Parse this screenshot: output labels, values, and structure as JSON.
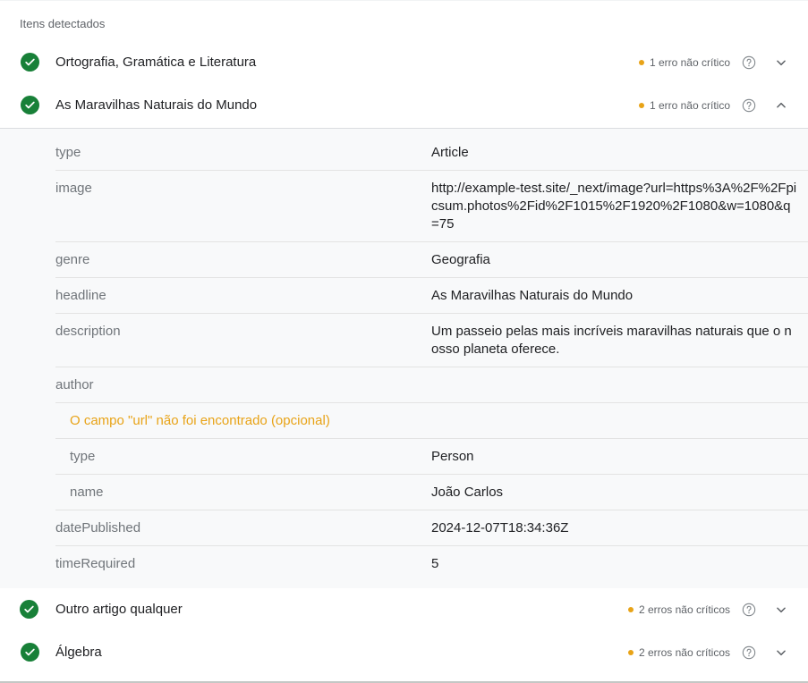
{
  "section_title": "Itens detectados",
  "colors": {
    "check": "#188038",
    "warning_dot": "#e8a317",
    "warning_text": "#e8a317"
  },
  "items": [
    {
      "title": "Ortografia, Gramática e Literatura",
      "warning": "1 erro não crítico",
      "expanded": false
    },
    {
      "title": "As Maravilhas Naturais do Mundo",
      "warning": "1 erro não crítico",
      "expanded": true
    },
    {
      "title": "Outro artigo qualquer",
      "warning": "2 erros não críticos",
      "expanded": false
    },
    {
      "title": "Álgebra",
      "warning": "2 erros não críticos",
      "expanded": false
    }
  ],
  "details": {
    "type": {
      "key": "type",
      "value": "Article"
    },
    "image": {
      "key": "image",
      "value": "http://example-test.site/_next/image?url=https%3A%2F%2Fpicsum.photos%2Fid%2F1015%2F1920%2F1080&w=1080&q=75"
    },
    "genre": {
      "key": "genre",
      "value": "Geografia"
    },
    "headline": {
      "key": "headline",
      "value": "As Maravilhas Naturais do Mundo"
    },
    "description": {
      "key": "description",
      "value": "Um passeio pelas mais incríveis maravilhas naturais que o nosso planeta oferece."
    },
    "author": {
      "key": "author",
      "warning": "O campo \"url\" não foi encontrado (opcional)",
      "type": {
        "key": "type",
        "value": "Person"
      },
      "name": {
        "key": "name",
        "value": "João Carlos"
      }
    },
    "datePublished": {
      "key": "datePublished",
      "value": "2024-12-07T18:34:36Z"
    },
    "timeRequired": {
      "key": "timeRequired",
      "value": "5"
    }
  },
  "icons": {
    "check": "check-circle-icon",
    "help": "help-circle-icon",
    "expand": "chevron-down-icon",
    "collapse": "chevron-up-icon"
  }
}
